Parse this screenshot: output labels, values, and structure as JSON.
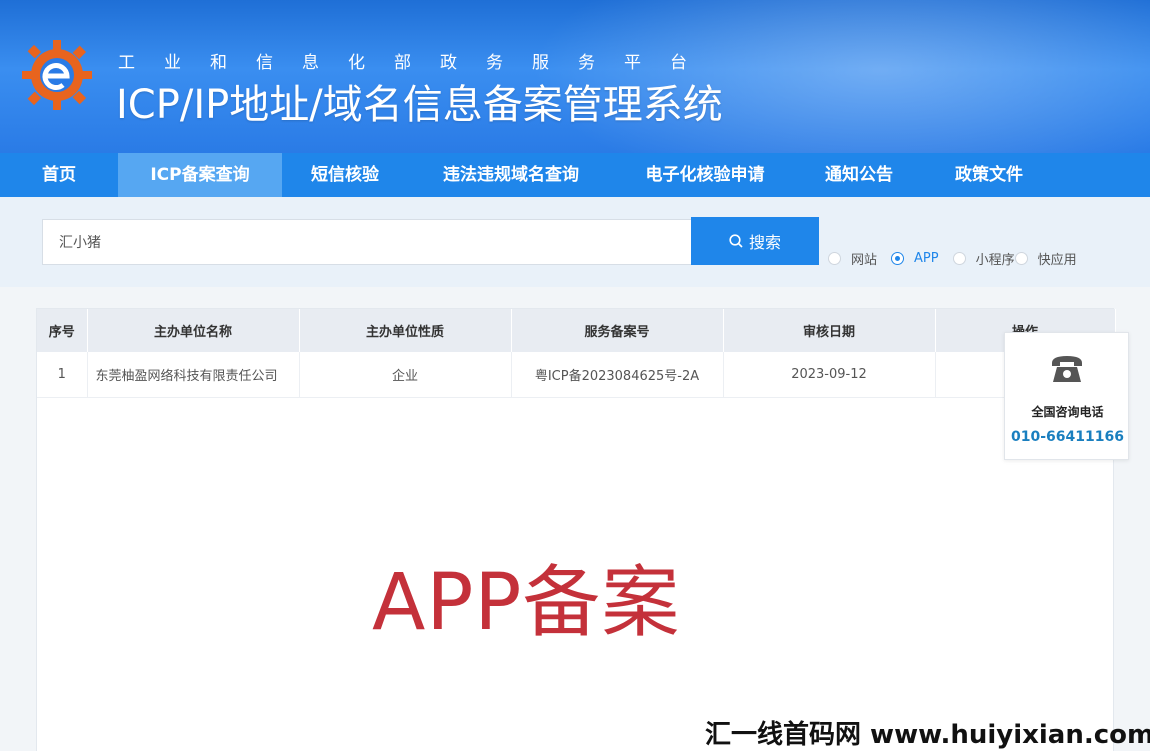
{
  "header": {
    "subtitle": "工业和信息化部政务服务平台",
    "title": "ICP/IP地址/域名信息备案管理系统",
    "logo_icon": "gear-e-logo-icon"
  },
  "nav": {
    "items": [
      {
        "label": "首页",
        "active": false
      },
      {
        "label": "ICP备案查询",
        "active": true
      },
      {
        "label": "短信核验",
        "active": false
      },
      {
        "label": "违法违规域名查询",
        "active": false
      },
      {
        "label": "电子化核验申请",
        "active": false
      },
      {
        "label": "通知公告",
        "active": false
      },
      {
        "label": "政策文件",
        "active": false
      }
    ]
  },
  "search": {
    "value": "汇小猪",
    "button_label": "搜索",
    "options": [
      {
        "label": "网站",
        "checked": false
      },
      {
        "label": "APP",
        "checked": true
      },
      {
        "label": "小程序",
        "checked": false
      },
      {
        "label": "快应用",
        "checked": false
      }
    ]
  },
  "table": {
    "headers": [
      "序号",
      "主办单位名称",
      "主办单位性质",
      "服务备案号",
      "审核日期",
      "操作"
    ],
    "rows": [
      [
        "1",
        "东莞柚盈网络科技有限责任公司",
        "企业",
        "粤ICP备2023084625号-2A",
        "2023-09-12",
        ""
      ]
    ]
  },
  "contact": {
    "label": "全国咨询电话",
    "phone": "010-66411166"
  },
  "overlay": {
    "app_text": "APP备案",
    "site_watermark": "汇一线首码网 www.huiyixian.com"
  },
  "colors": {
    "primary": "#1f86ea",
    "nav_active": "#56a7f2",
    "accent_red": "#c4313a",
    "phone_blue": "#1a7fbf"
  }
}
